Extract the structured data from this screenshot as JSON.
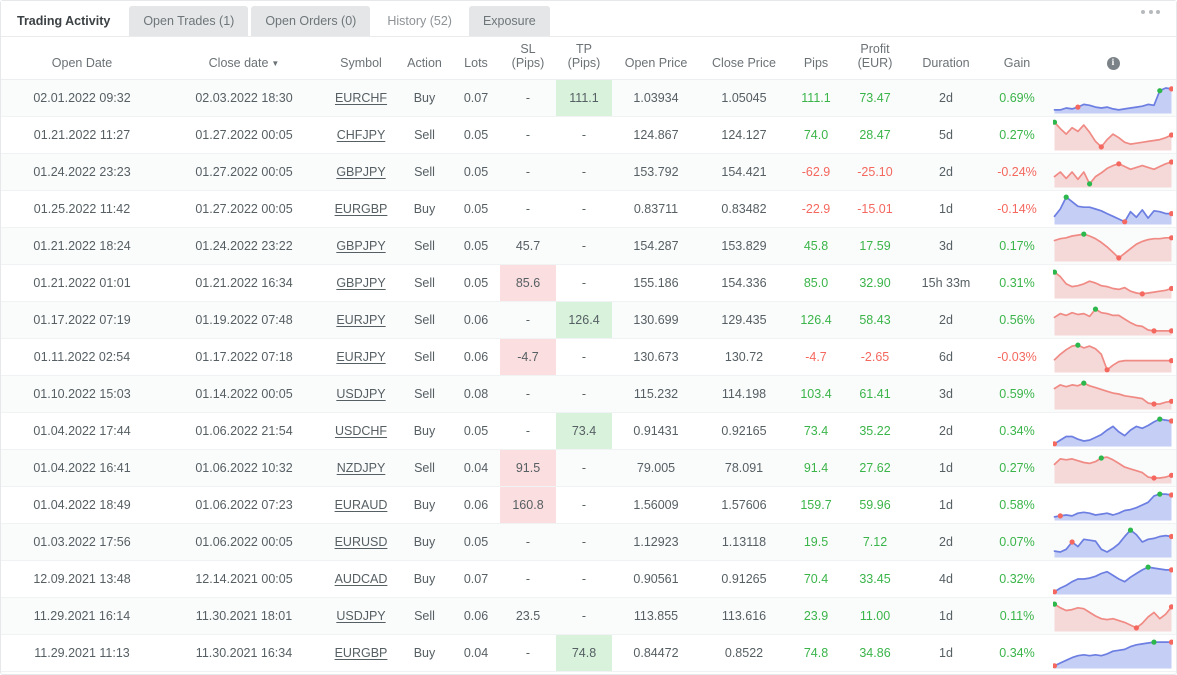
{
  "tabs": [
    {
      "label": "Trading Activity",
      "state": "first"
    },
    {
      "label": "Open Trades (1)",
      "state": "idle"
    },
    {
      "label": "Open Orders (0)",
      "state": "idle"
    },
    {
      "label": "History (52)",
      "state": "active"
    },
    {
      "label": "Exposure",
      "state": "idle"
    }
  ],
  "overflow_menu": "more-options",
  "colors": {
    "positive": "#3bb54a",
    "negative": "#f4685f",
    "highlight_green": "#d8f2dc",
    "highlight_red": "#fbdedf",
    "buy_line": "#6c7ee1",
    "buy_fill": "#c5cef5",
    "sell_line": "#f08a84",
    "sell_fill": "#f5d9d8",
    "dot_start": "#2db84d",
    "dot_end": "#f4685f"
  },
  "table": {
    "columns": [
      {
        "key": "open_date",
        "label": "Open Date",
        "sub": ""
      },
      {
        "key": "close_date",
        "label": "Close date",
        "sub": "",
        "sorted": true,
        "sort_dir": "desc"
      },
      {
        "key": "symbol",
        "label": "Symbol",
        "sub": ""
      },
      {
        "key": "action",
        "label": "Action",
        "sub": ""
      },
      {
        "key": "lots",
        "label": "Lots",
        "sub": ""
      },
      {
        "key": "sl",
        "label": "SL",
        "sub": "(Pips)"
      },
      {
        "key": "tp",
        "label": "TP",
        "sub": "(Pips)"
      },
      {
        "key": "open_price",
        "label": "Open Price",
        "sub": ""
      },
      {
        "key": "close_price",
        "label": "Close Price",
        "sub": ""
      },
      {
        "key": "pips",
        "label": "Pips",
        "sub": ""
      },
      {
        "key": "profit",
        "label": "Profit",
        "sub": "(EUR)"
      },
      {
        "key": "duration",
        "label": "Duration",
        "sub": ""
      },
      {
        "key": "gain",
        "label": "Gain",
        "sub": ""
      },
      {
        "key": "chart",
        "label": "info-icon",
        "sub": ""
      }
    ],
    "rows": [
      {
        "open_date": "02.01.2022 09:32",
        "close_date": "02.03.2022 18:30",
        "symbol": "EURCHF",
        "action": "Buy",
        "lots": "0.07",
        "sl": "-",
        "tp": "111.1",
        "sl_hl": "none",
        "tp_hl": "green",
        "open_price": "1.03934",
        "close_price": "1.05045",
        "pips": "111.1",
        "profit": "73.47",
        "duration": "2d",
        "gain": "0.69%",
        "sign": "pos",
        "chart_type": "buy",
        "points": [
          30,
          30,
          28,
          29,
          27,
          24,
          25,
          27,
          28,
          27,
          29,
          30,
          29,
          28,
          27,
          26,
          24,
          25,
          9,
          6,
          7
        ],
        "dot_start_i": 18,
        "dot_end_i": 20,
        "dot_low_i": 4
      },
      {
        "open_date": "01.21.2022 11:27",
        "close_date": "01.27.2022 00:05",
        "symbol": "CHFJPY",
        "action": "Sell",
        "lots": "0.05",
        "sl": "-",
        "tp": "-",
        "sl_hl": "none",
        "tp_hl": "none",
        "open_price": "124.867",
        "close_price": "124.127",
        "pips": "74.0",
        "profit": "28.47",
        "duration": "5d",
        "gain": "0.27%",
        "sign": "pos",
        "chart_type": "sell",
        "points": [
          3,
          10,
          16,
          9,
          13,
          6,
          14,
          24,
          30,
          22,
          16,
          20,
          25,
          27,
          26,
          25,
          24,
          23,
          22,
          20,
          17
        ],
        "dot_start_i": 0,
        "dot_end_i": 20,
        "dot_low_i": 8
      },
      {
        "open_date": "01.24.2022 23:23",
        "close_date": "01.27.2022 00:05",
        "symbol": "GBPJPY",
        "action": "Sell",
        "lots": "0.05",
        "sl": "-",
        "tp": "-",
        "sl_hl": "none",
        "tp_hl": "none",
        "open_price": "153.792",
        "close_price": "154.421",
        "pips": "-62.9",
        "profit": "-25.10",
        "duration": "2d",
        "gain": "-0.24%",
        "sign": "neg",
        "chart_type": "sell",
        "points": [
          22,
          17,
          24,
          17,
          25,
          17,
          30,
          22,
          18,
          13,
          10,
          8,
          11,
          14,
          12,
          10,
          12,
          14,
          11,
          8,
          6
        ],
        "dot_start_i": 6,
        "dot_end_i": 20,
        "dot_low_i": 11
      },
      {
        "open_date": "01.25.2022 11:42",
        "close_date": "01.27.2022 00:05",
        "symbol": "EURGBP",
        "action": "Buy",
        "lots": "0.05",
        "sl": "-",
        "tp": "-",
        "sl_hl": "none",
        "tp_hl": "none",
        "open_price": "0.83711",
        "close_price": "0.83482",
        "pips": "-22.9",
        "profit": "-15.01",
        "duration": "1d",
        "gain": "-0.14%",
        "sign": "neg",
        "chart_type": "buy",
        "points": [
          25,
          17,
          4,
          9,
          14,
          15,
          15,
          17,
          19,
          22,
          25,
          28,
          31,
          20,
          26,
          18,
          27,
          19,
          20,
          22,
          22
        ],
        "dot_start_i": 2,
        "dot_end_i": 20,
        "dot_low_i": 12
      },
      {
        "open_date": "01.21.2022 18:24",
        "close_date": "01.24.2022 23:22",
        "symbol": "GBPJPY",
        "action": "Sell",
        "lots": "0.05",
        "sl": "45.7",
        "tp": "-",
        "sl_hl": "none",
        "tp_hl": "none",
        "open_price": "154.287",
        "close_price": "153.829",
        "pips": "45.8",
        "profit": "17.59",
        "duration": "3d",
        "gain": "0.17%",
        "sign": "pos",
        "chart_type": "sell",
        "points": [
          11,
          9,
          8,
          6,
          5,
          4,
          6,
          9,
          13,
          18,
          24,
          30,
          25,
          20,
          15,
          12,
          10,
          9,
          9,
          8,
          8
        ],
        "dot_start_i": 5,
        "dot_end_i": 20,
        "dot_low_i": 11
      },
      {
        "open_date": "01.21.2022 01:01",
        "close_date": "01.21.2022 16:34",
        "symbol": "GBPJPY",
        "action": "Sell",
        "lots": "0.05",
        "sl": "85.6",
        "tp": "-",
        "sl_hl": "red",
        "tp_hl": "none",
        "open_price": "155.186",
        "close_price": "154.336",
        "pips": "85.0",
        "profit": "32.90",
        "duration": "15h 33m",
        "gain": "0.31%",
        "sign": "pos",
        "chart_type": "sell",
        "points": [
          5,
          10,
          18,
          21,
          20,
          18,
          15,
          17,
          20,
          21,
          23,
          24,
          22,
          26,
          28,
          29,
          28,
          27,
          26,
          25,
          23
        ],
        "dot_start_i": 0,
        "dot_end_i": 20,
        "dot_low_i": 15
      },
      {
        "open_date": "01.17.2022 07:19",
        "close_date": "01.19.2022 07:48",
        "symbol": "EURJPY",
        "action": "Sell",
        "lots": "0.06",
        "sl": "-",
        "tp": "126.4",
        "sl_hl": "none",
        "tp_hl": "green",
        "open_price": "130.699",
        "close_price": "129.435",
        "pips": "126.4",
        "profit": "58.43",
        "duration": "2d",
        "gain": "0.56%",
        "sign": "pos",
        "chart_type": "sell",
        "points": [
          14,
          10,
          12,
          9,
          11,
          10,
          13,
          5,
          9,
          10,
          12,
          12,
          16,
          20,
          23,
          24,
          28,
          29,
          29,
          29,
          29
        ],
        "dot_start_i": 7,
        "dot_end_i": 20,
        "dot_low_i": 17
      },
      {
        "open_date": "01.11.2022 02:54",
        "close_date": "01.17.2022 07:18",
        "symbol": "EURJPY",
        "action": "Sell",
        "lots": "0.06",
        "sl": "-4.7",
        "tp": "-",
        "sl_hl": "red",
        "tp_hl": "none",
        "open_price": "130.673",
        "close_price": "130.72",
        "pips": "-4.7",
        "profit": "-2.65",
        "duration": "6d",
        "gain": "-0.03%",
        "sign": "neg",
        "chart_type": "sell",
        "points": [
          20,
          14,
          9,
          5,
          4,
          7,
          5,
          8,
          14,
          31,
          26,
          22,
          21,
          21,
          21,
          21,
          21,
          21,
          21,
          21,
          21
        ],
        "dot_start_i": 4,
        "dot_end_i": 20,
        "dot_low_i": 9
      },
      {
        "open_date": "01.10.2022 15:03",
        "close_date": "01.14.2022 00:05",
        "symbol": "USDJPY",
        "action": "Sell",
        "lots": "0.08",
        "sl": "-",
        "tp": "-",
        "sl_hl": "none",
        "tp_hl": "none",
        "open_price": "115.232",
        "close_price": "114.198",
        "pips": "103.4",
        "profit": "61.41",
        "duration": "3d",
        "gain": "0.59%",
        "sign": "pos",
        "chart_type": "sell",
        "points": [
          11,
          7,
          9,
          7,
          8,
          5,
          8,
          10,
          12,
          14,
          16,
          17,
          19,
          20,
          21,
          22,
          27,
          28,
          28,
          26,
          25
        ],
        "dot_start_i": 5,
        "dot_end_i": 20,
        "dot_low_i": 17
      },
      {
        "open_date": "01.04.2022 17:44",
        "close_date": "01.06.2022 21:54",
        "symbol": "USDCHF",
        "action": "Buy",
        "lots": "0.05",
        "sl": "-",
        "tp": "73.4",
        "sl_hl": "none",
        "tp_hl": "green",
        "open_price": "0.91431",
        "close_price": "0.92165",
        "pips": "73.4",
        "profit": "35.22",
        "duration": "2d",
        "gain": "0.34%",
        "sign": "pos",
        "chart_type": "buy",
        "points": [
          31,
          27,
          23,
          23,
          26,
          28,
          27,
          24,
          21,
          16,
          12,
          18,
          22,
          16,
          12,
          14,
          11,
          7,
          4,
          5,
          6
        ],
        "dot_start_i": 18,
        "dot_end_i": 20,
        "dot_low_i": 0
      },
      {
        "open_date": "01.04.2022 16:41",
        "close_date": "01.06.2022 10:32",
        "symbol": "NZDJPY",
        "action": "Sell",
        "lots": "0.04",
        "sl": "91.5",
        "tp": "-",
        "sl_hl": "red",
        "tp_hl": "none",
        "open_price": "79.005",
        "close_price": "78.091",
        "pips": "91.4",
        "profit": "27.62",
        "duration": "1d",
        "gain": "0.27%",
        "sign": "pos",
        "chart_type": "sell",
        "points": [
          13,
          7,
          8,
          7,
          9,
          11,
          12,
          10,
          6,
          5,
          8,
          12,
          16,
          18,
          20,
          22,
          27,
          28,
          28,
          27,
          25
        ],
        "dot_start_i": 8,
        "dot_end_i": 20,
        "dot_low_i": 17
      },
      {
        "open_date": "01.04.2022 18:49",
        "close_date": "01.06.2022 07:23",
        "symbol": "EURAUD",
        "action": "Buy",
        "lots": "0.06",
        "sl": "160.8",
        "tp": "-",
        "sl_hl": "red",
        "tp_hl": "none",
        "open_price": "1.56009",
        "close_price": "1.57606",
        "pips": "159.7",
        "profit": "59.96",
        "duration": "1d",
        "gain": "0.58%",
        "sign": "pos",
        "chart_type": "buy",
        "points": [
          30,
          29,
          28,
          29,
          26,
          25,
          26,
          28,
          27,
          26,
          28,
          26,
          23,
          22,
          20,
          17,
          14,
          7,
          5,
          5,
          6
        ],
        "dot_start_i": 18,
        "dot_end_i": 20,
        "dot_low_i": 1
      },
      {
        "open_date": "01.03.2022 17:56",
        "close_date": "01.06.2022 00:05",
        "symbol": "EURUSD",
        "action": "Buy",
        "lots": "0.05",
        "sl": "-",
        "tp": "-",
        "sl_hl": "none",
        "tp_hl": "none",
        "open_price": "1.12923",
        "close_price": "1.13118",
        "pips": "19.5",
        "profit": "7.12",
        "duration": "2d",
        "gain": "0.07%",
        "sign": "pos",
        "chart_type": "buy",
        "points": [
          27,
          28,
          25,
          17,
          22,
          14,
          15,
          16,
          25,
          28,
          24,
          19,
          11,
          4,
          9,
          17,
          14,
          13,
          11,
          10,
          11
        ],
        "dot_start_i": 13,
        "dot_end_i": 20,
        "dot_low_i": 3
      },
      {
        "open_date": "12.09.2021 13:48",
        "close_date": "12.14.2021 00:05",
        "symbol": "AUDCAD",
        "action": "Buy",
        "lots": "0.07",
        "sl": "-",
        "tp": "-",
        "sl_hl": "none",
        "tp_hl": "none",
        "open_price": "0.90561",
        "close_price": "0.91265",
        "pips": "70.4",
        "profit": "33.45",
        "duration": "4d",
        "gain": "0.32%",
        "sign": "pos",
        "chart_type": "buy",
        "points": [
          31,
          27,
          24,
          20,
          17,
          17,
          16,
          14,
          11,
          9,
          13,
          17,
          20,
          15,
          11,
          7,
          4,
          5,
          6,
          7,
          7
        ],
        "dot_start_i": 16,
        "dot_end_i": 20,
        "dot_low_i": 0
      },
      {
        "open_date": "11.29.2021 16:14",
        "close_date": "11.30.2021 18:01",
        "symbol": "USDJPY",
        "action": "Sell",
        "lots": "0.06",
        "sl": "23.5",
        "tp": "-",
        "sl_hl": "none",
        "tp_hl": "none",
        "open_price": "113.855",
        "close_price": "113.616",
        "pips": "23.9",
        "profit": "11.00",
        "duration": "1d",
        "gain": "0.11%",
        "sign": "pos",
        "chart_type": "sell",
        "points": [
          4,
          8,
          11,
          10,
          8,
          9,
          13,
          17,
          20,
          21,
          20,
          22,
          24,
          27,
          30,
          25,
          18,
          13,
          20,
          15,
          7
        ],
        "dot_start_i": 0,
        "dot_end_i": 20,
        "dot_low_i": 14
      },
      {
        "open_date": "11.29.2021 11:13",
        "close_date": "11.30.2021 16:34",
        "symbol": "EURGBP",
        "action": "Buy",
        "lots": "0.04",
        "sl": "-",
        "tp": "74.8",
        "sl_hl": "none",
        "tp_hl": "green",
        "open_price": "0.84472",
        "close_price": "0.8522",
        "pips": "74.8",
        "profit": "34.86",
        "duration": "1d",
        "gain": "0.34%",
        "sign": "pos",
        "chart_type": "buy",
        "points": [
          31,
          28,
          25,
          22,
          20,
          19,
          20,
          19,
          20,
          18,
          15,
          14,
          13,
          10,
          8,
          7,
          6,
          5,
          5,
          5,
          5
        ],
        "dot_start_i": 17,
        "dot_end_i": 20,
        "dot_low_i": 0
      }
    ]
  }
}
